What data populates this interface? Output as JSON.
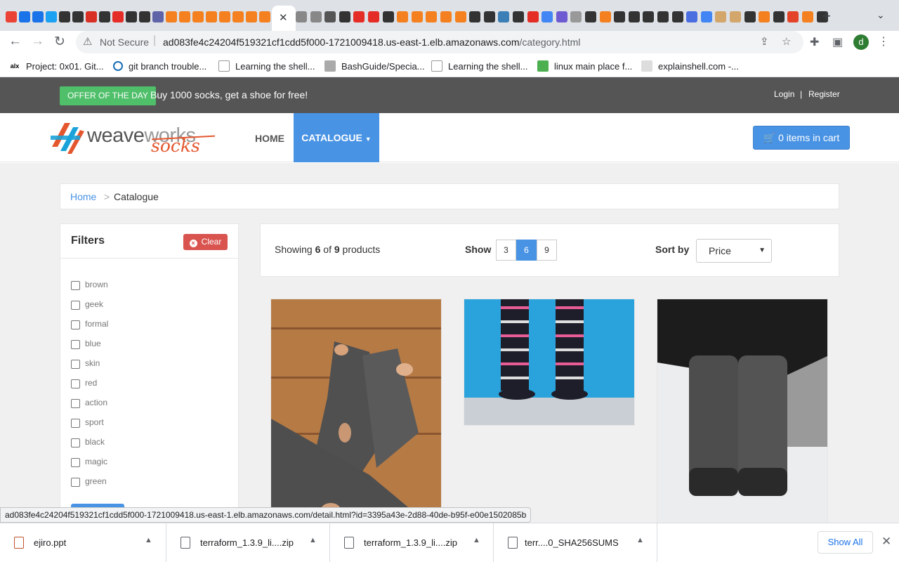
{
  "browser": {
    "tab_close": "✕",
    "new_tab": "+",
    "security": "Not Securе",
    "url_host": "ad083fe4c24204f519321cf1cdd5f000-1721009418.us-east-1.elb.amazonaws.com",
    "url_path": "/category.html",
    "profile_initial": "d",
    "bookmarks": [
      {
        "label": "Project: 0x01. Git...",
        "icon": "alx-icon"
      },
      {
        "label": "git branch trouble...",
        "icon": "stackoverflow-icon"
      },
      {
        "label": "Learning the shell...",
        "icon": "page-icon"
      },
      {
        "label": "BashGuide/Specia...",
        "icon": "wooledge-icon"
      },
      {
        "label": "Learning the shell...",
        "icon": "page-icon"
      },
      {
        "label": "linux main place f...",
        "icon": "leaf-icon"
      },
      {
        "label": "explainshell.com -...",
        "icon": "shell-icon"
      }
    ]
  },
  "site": {
    "offer_badge": "OFFER OF THE DAY",
    "offer_text": "Buy 1000 socks, get a shoe for free!",
    "login": "Login",
    "separator": "|",
    "register": "Register",
    "logo_weave": "weave",
    "logo_works": "works",
    "logo_socks": "socks",
    "nav_home": "HOME",
    "nav_catalogue": "CATALOGUE",
    "cart": "0 items in cart",
    "breadcrumb_home": "Home",
    "breadcrumb_sep": ">",
    "breadcrumb_current": "Catalogue"
  },
  "filters": {
    "title": "Filters",
    "clear": "Clear",
    "tags": [
      "brown",
      "geek",
      "formal",
      "blue",
      "skin",
      "red",
      "action",
      "sport",
      "black",
      "magic",
      "green"
    ]
  },
  "listing": {
    "showing_prefix": "Showing ",
    "showing_count": "6",
    "showing_of": " of ",
    "showing_total": "9",
    "showing_suffix": " products",
    "show_label": "Show",
    "page_sizes": [
      "3",
      "6",
      "9"
    ],
    "active_page_size": "6",
    "sort_label": "Sort by",
    "sort_value": "Price"
  },
  "status_url": "ad083fe4c24204f519321cf1cdd5f000-1721009418.us-east-1.elb.amazonaws.com/detail.html?id=3395a43e-2d88-40de-b95f-e00e1502085b",
  "downloads": {
    "items": [
      "ejiro.ppt",
      "terraform_1.3.9_li....zip",
      "terraform_1.3.9_li....zip",
      "terr....0_SHA256SUMS"
    ],
    "show_all": "Show All"
  },
  "colors": {
    "accent": "#4993e4",
    "offer_green": "#4fbf6a",
    "clear_red": "#d9534f",
    "topbar": "#555555"
  }
}
